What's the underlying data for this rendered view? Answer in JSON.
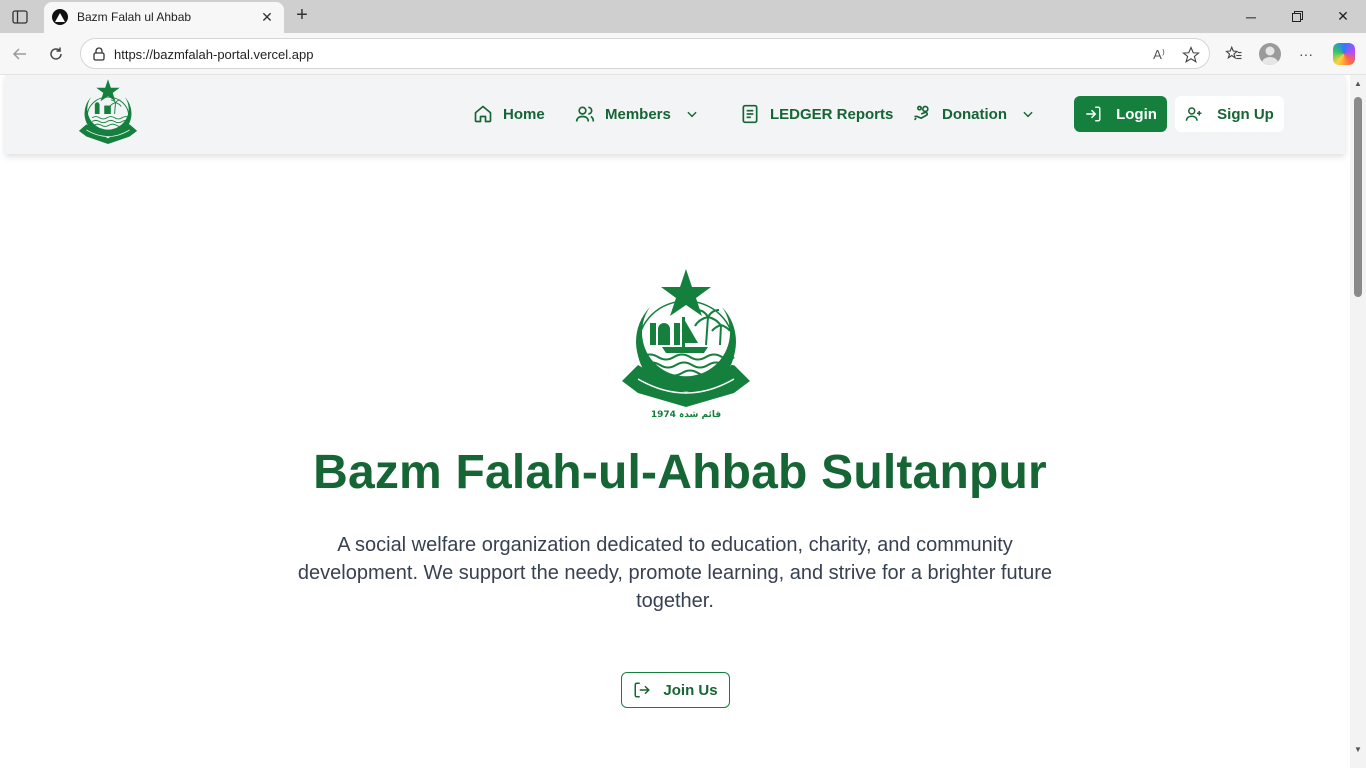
{
  "browser": {
    "tab_title": "Bazm Falah ul Ahbab",
    "url": "https://bazmfalah-portal.vercel.app",
    "read_aloud_label": "A⁾"
  },
  "nav": {
    "items": [
      {
        "label": "Home",
        "icon": "home-icon"
      },
      {
        "label": "Members",
        "icon": "users-icon",
        "dropdown": true
      },
      {
        "label": "LEDGER Reports",
        "icon": "report-icon"
      },
      {
        "label": "Donation",
        "icon": "hand-coins-icon",
        "dropdown": true
      }
    ],
    "login_label": "Login",
    "signup_label": "Sign Up"
  },
  "hero": {
    "title": "Bazm Falah-ul-Ahbab Sultanpur",
    "description": "A social welfare organization dedicated to education, charity, and community development. We support the needy, promote learning, and strive for a brighter future together.",
    "join_label": "Join Us",
    "logo_year_text": "1974 قائم شدہ"
  },
  "colors": {
    "brand_green": "#166534",
    "button_green": "#15803d",
    "header_bg": "#f3f4f6",
    "text_gray": "#374151"
  }
}
